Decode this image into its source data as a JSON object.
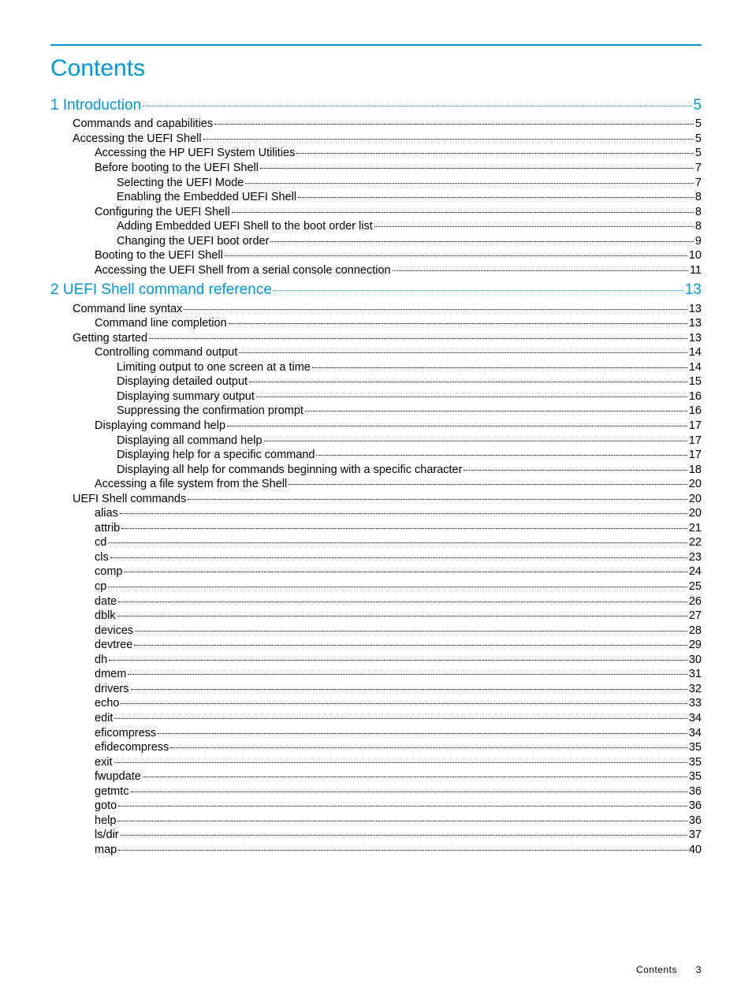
{
  "title": "Contents",
  "footer": {
    "label": "Contents",
    "page": "3"
  },
  "toc": [
    {
      "level": 0,
      "chapter": true,
      "label": "1 Introduction",
      "page": "5"
    },
    {
      "level": 1,
      "chapter": false,
      "label": "Commands and capabilities",
      "page": "5"
    },
    {
      "level": 1,
      "chapter": false,
      "label": "Accessing the UEFI Shell",
      "page": "5"
    },
    {
      "level": 2,
      "chapter": false,
      "label": "Accessing the HP UEFI System Utilities",
      "page": "5"
    },
    {
      "level": 2,
      "chapter": false,
      "label": "Before booting to the UEFI Shell",
      "page": "7"
    },
    {
      "level": 3,
      "chapter": false,
      "label": "Selecting the UEFI Mode",
      "page": "7"
    },
    {
      "level": 3,
      "chapter": false,
      "label": "Enabling the Embedded UEFI Shell",
      "page": "8"
    },
    {
      "level": 2,
      "chapter": false,
      "label": "Configuring the UEFI Shell",
      "page": "8"
    },
    {
      "level": 3,
      "chapter": false,
      "label": "Adding Embedded UEFI Shell to the boot order list",
      "page": "8"
    },
    {
      "level": 3,
      "chapter": false,
      "label": "Changing the UEFI boot order",
      "page": "9"
    },
    {
      "level": 2,
      "chapter": false,
      "label": "Booting to the UEFI Shell",
      "page": "10"
    },
    {
      "level": 2,
      "chapter": false,
      "label": "Accessing the UEFI Shell from a serial console connection",
      "page": "11"
    },
    {
      "level": 0,
      "chapter": true,
      "label": "2 UEFI Shell command reference",
      "page": "13"
    },
    {
      "level": 1,
      "chapter": false,
      "label": "Command line syntax",
      "page": "13"
    },
    {
      "level": 2,
      "chapter": false,
      "label": "Command line completion",
      "page": "13"
    },
    {
      "level": 1,
      "chapter": false,
      "label": "Getting started ",
      "page": "13"
    },
    {
      "level": 2,
      "chapter": false,
      "label": "Controlling command output",
      "page": "14"
    },
    {
      "level": 3,
      "chapter": false,
      "label": "Limiting output to one screen at a time",
      "page": "14"
    },
    {
      "level": 3,
      "chapter": false,
      "label": "Displaying detailed output",
      "page": "15"
    },
    {
      "level": 3,
      "chapter": false,
      "label": "Displaying summary output",
      "page": "16"
    },
    {
      "level": 3,
      "chapter": false,
      "label": "Suppressing the confirmation prompt",
      "page": "16"
    },
    {
      "level": 2,
      "chapter": false,
      "label": "Displaying command help",
      "page": "17"
    },
    {
      "level": 3,
      "chapter": false,
      "label": "Displaying all command help",
      "page": "17"
    },
    {
      "level": 3,
      "chapter": false,
      "label": "Displaying help for a specific command",
      "page": "17"
    },
    {
      "level": 3,
      "chapter": false,
      "label": "Displaying all help for commands beginning with a specific character",
      "page": "18"
    },
    {
      "level": 2,
      "chapter": false,
      "label": "Accessing a file system from the Shell",
      "page": "20"
    },
    {
      "level": 1,
      "chapter": false,
      "label": "UEFI Shell commands",
      "page": "20"
    },
    {
      "level": 2,
      "chapter": false,
      "label": "alias",
      "page": "20"
    },
    {
      "level": 2,
      "chapter": false,
      "label": "attrib",
      "page": "21"
    },
    {
      "level": 2,
      "chapter": false,
      "label": "cd",
      "page": "22"
    },
    {
      "level": 2,
      "chapter": false,
      "label": "cls",
      "page": "23"
    },
    {
      "level": 2,
      "chapter": false,
      "label": "comp",
      "page": "24"
    },
    {
      "level": 2,
      "chapter": false,
      "label": "cp",
      "page": "25"
    },
    {
      "level": 2,
      "chapter": false,
      "label": "date",
      "page": "26"
    },
    {
      "level": 2,
      "chapter": false,
      "label": "dblk",
      "page": "27"
    },
    {
      "level": 2,
      "chapter": false,
      "label": "devices",
      "page": "28"
    },
    {
      "level": 2,
      "chapter": false,
      "label": "devtree",
      "page": "29"
    },
    {
      "level": 2,
      "chapter": false,
      "label": "dh",
      "page": "30"
    },
    {
      "level": 2,
      "chapter": false,
      "label": "dmem",
      "page": "31"
    },
    {
      "level": 2,
      "chapter": false,
      "label": "drivers",
      "page": "32"
    },
    {
      "level": 2,
      "chapter": false,
      "label": "echo",
      "page": "33"
    },
    {
      "level": 2,
      "chapter": false,
      "label": "edit",
      "page": "34"
    },
    {
      "level": 2,
      "chapter": false,
      "label": "eficompress",
      "page": "34"
    },
    {
      "level": 2,
      "chapter": false,
      "label": "efidecompress",
      "page": "35"
    },
    {
      "level": 2,
      "chapter": false,
      "label": "exit",
      "page": "35"
    },
    {
      "level": 2,
      "chapter": false,
      "label": "fwupdate",
      "page": "35"
    },
    {
      "level": 2,
      "chapter": false,
      "label": "getmtc",
      "page": "36"
    },
    {
      "level": 2,
      "chapter": false,
      "label": "goto",
      "page": "36"
    },
    {
      "level": 2,
      "chapter": false,
      "label": "help",
      "page": "36"
    },
    {
      "level": 2,
      "chapter": false,
      "label": "ls/dir",
      "page": "37"
    },
    {
      "level": 2,
      "chapter": false,
      "label": "map",
      "page": "40"
    }
  ]
}
